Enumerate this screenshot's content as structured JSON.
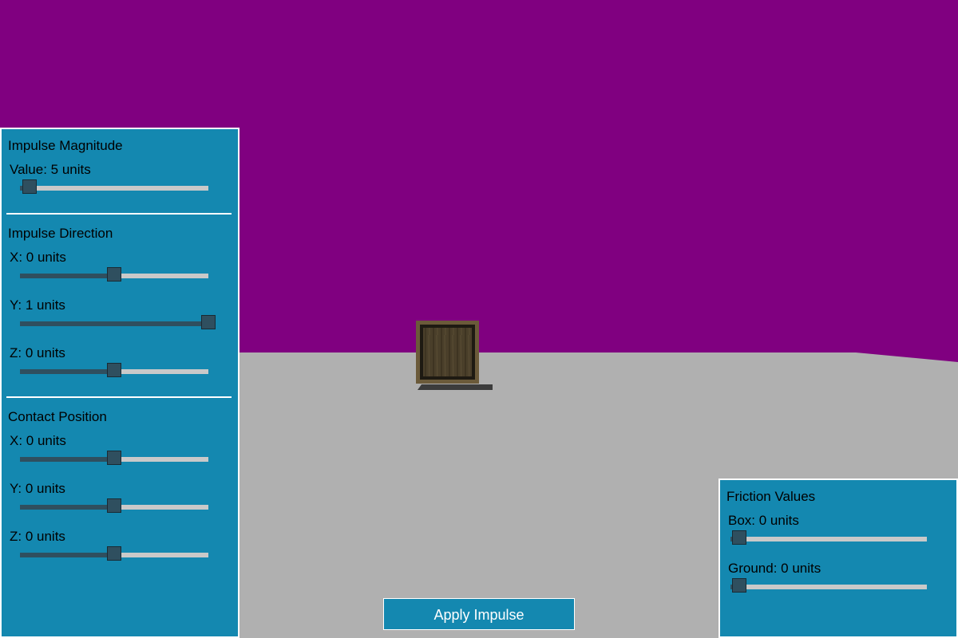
{
  "colors": {
    "sky": "#800080",
    "ground": "#b0b0b0",
    "panel": "#1488b0",
    "panel_border": "#ffffff",
    "slider_track": "#c9c9c9",
    "slider_fill": "#2f4f5f"
  },
  "impulse_magnitude": {
    "title": "Impulse Magnitude",
    "value_label": "Value: 5 units",
    "fraction": 0.05
  },
  "impulse_direction": {
    "title": "Impulse Direction",
    "x": {
      "label": "X: 0 units",
      "fraction": 0.5
    },
    "y": {
      "label": "Y: 1 units",
      "fraction": 1.0
    },
    "z": {
      "label": "Z: 0 units",
      "fraction": 0.5
    }
  },
  "contact_position": {
    "title": "Contact Position",
    "x": {
      "label": "X: 0 units",
      "fraction": 0.5
    },
    "y": {
      "label": "Y: 0 units",
      "fraction": 0.5
    },
    "z": {
      "label": "Z: 0 units",
      "fraction": 0.5
    }
  },
  "friction": {
    "title": "Friction Values",
    "box": {
      "label": "Box: 0 units",
      "fraction": 0.0
    },
    "ground": {
      "label": "Ground: 0 units",
      "fraction": 0.0
    }
  },
  "apply_button_label": "Apply Impulse"
}
